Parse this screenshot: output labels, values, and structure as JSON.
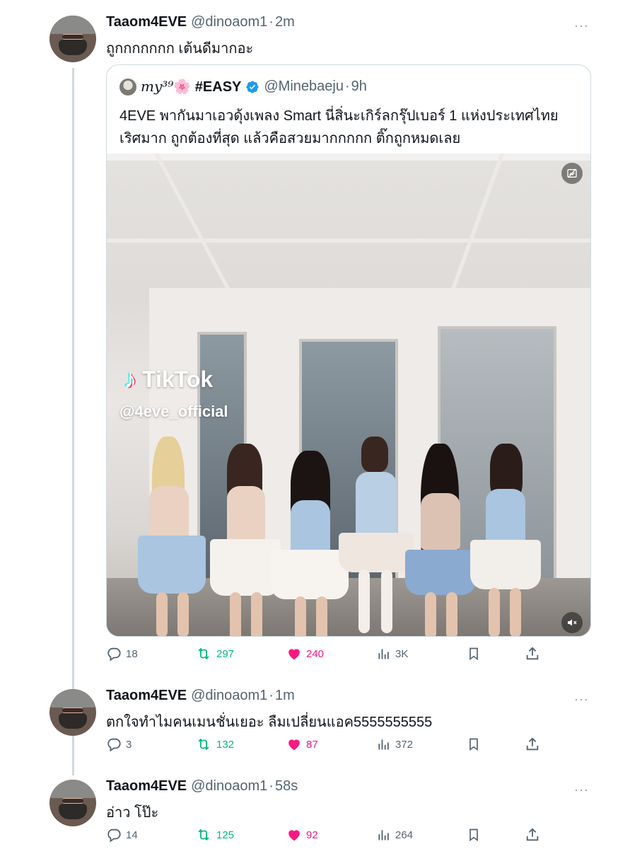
{
  "tweets": [
    {
      "name": "Taaom4EVE",
      "handle": "@dinoaom1",
      "time": "2m",
      "text": "ถูกกกกกกก เต้นดีมากอะ",
      "replies": "18",
      "retweets": "297",
      "likes": "240",
      "views": "3K"
    },
    {
      "name": "Taaom4EVE",
      "handle": "@dinoaom1",
      "time": "1m",
      "text": "ตกใจทำไมคนเมนชั่นเยอะ ลืมเปลี่ยนแอค5555555555",
      "replies": "3",
      "retweets": "132",
      "likes": "87",
      "views": "372"
    },
    {
      "name": "Taaom4EVE",
      "handle": "@dinoaom1",
      "time": "58s",
      "text": "อ่าว โป๊ะ",
      "replies": "14",
      "retweets": "125",
      "likes": "92",
      "views": "264"
    }
  ],
  "quote": {
    "name_script": "my³⁹",
    "name_emoji": "🌸",
    "name_tag": "#EASY",
    "handle": "@Minebaeju",
    "time": "9h",
    "text_line1": "4EVE พากันมาเอวดุ้งเพลง Smart นี่สิ่นะเกิร์ลกรุ๊ปเบอร์ 1 แห่งประเทศไทย",
    "text_line2": "เริศมาก ถูกต้องที่สุด แล้วคือสวยมากกกกก ติ๊กถูกหมดเลย",
    "media_watermark_brand": "TikTok",
    "media_watermark_handle": "@4eve_official"
  },
  "ui": {
    "more_label": "···",
    "dot": "·"
  },
  "colors": {
    "text": "#0f1419",
    "secondary": "#536471",
    "retweet": "#00ba7c",
    "like": "#f91880",
    "verified": "#1d9bf0",
    "thread_line": "#cfd9de"
  },
  "icons": [
    "reply-icon",
    "retweet-icon",
    "heart-icon",
    "views-icon",
    "bookmark-icon",
    "share-icon",
    "verified-icon",
    "alt-text-icon",
    "mute-icon"
  ]
}
